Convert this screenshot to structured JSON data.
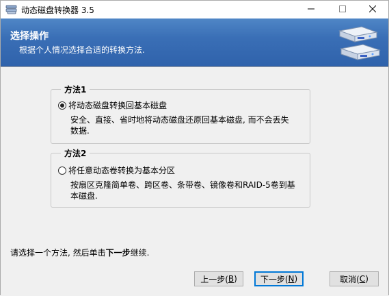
{
  "window": {
    "title": "动态磁盘转换器 3.5",
    "icons": {
      "app": "disk-app-icon",
      "minimize": "minimize-icon",
      "maximize": "maximize-icon",
      "close": "close-icon"
    }
  },
  "header": {
    "title": "选择操作",
    "subtitle": "根据个人情况选择合适的转换方法.",
    "art": "disk-drives-icon",
    "gradient": [
      "#4f86c6",
      "#2f62ab"
    ]
  },
  "methods": [
    {
      "legend": "方法1",
      "option": "将动态磁盘转换回基本磁盘",
      "selected": true,
      "description": "安全、直接、省时地将动态磁盘还原回基本磁盘, 而不会丢失数据."
    },
    {
      "legend": "方法2",
      "option": "将任意动态卷转换为基本分区",
      "selected": false,
      "description": "按扇区克隆简单卷、跨区卷、条带卷、镜像卷和RAID-5卷到基本磁盘."
    }
  ],
  "hint": {
    "before": "请选择一个方法, 然后单击",
    "emphasis": "下一步",
    "after": "继续."
  },
  "buttons": {
    "back": {
      "label": "上一步(",
      "key": "B",
      "end": ")"
    },
    "next": {
      "label": "下一步(",
      "key": "N",
      "end": ")"
    },
    "cancel": {
      "label": "取消(",
      "key": "C",
      "end": ")"
    }
  },
  "colors": {
    "accent": "#0078d7",
    "panel": "#f0f0f0"
  }
}
